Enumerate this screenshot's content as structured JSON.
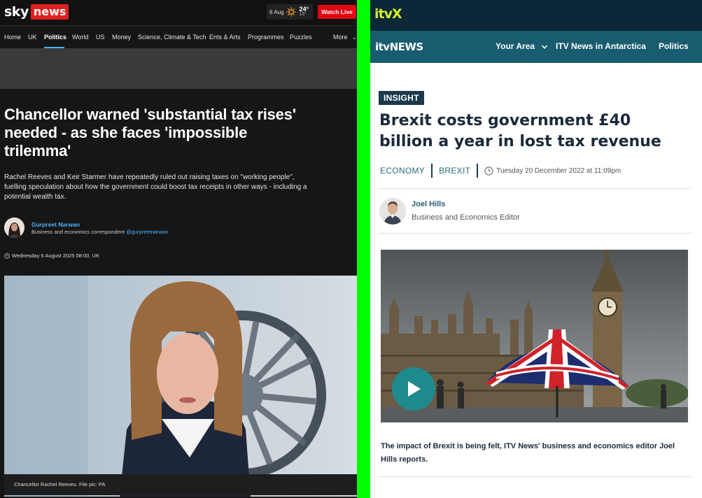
{
  "sky": {
    "logo_word": "sky",
    "logo_news": "news",
    "weather": {
      "date": "6 Aug",
      "high": "24°",
      "low": "16°"
    },
    "watch_live": "Watch Live",
    "nav": [
      "Home",
      "UK",
      "Politics",
      "World",
      "US",
      "Money",
      "Science, Climate & Tech",
      "Ents & Arts",
      "Programmes",
      "Puzzles"
    ],
    "nav_active": "Politics",
    "nav_more": "More",
    "headline": "Chancellor warned 'substantial tax rises' needed - as she faces 'impossible trilemma'",
    "standfirst": "Rachel Reeves and Keir Starmer have repeatedly ruled out raising taxes on \"working people\", fuelling speculation about how the government could boost tax receipts in other ways - including a potential wealth tax.",
    "author": {
      "name": "Gurpreet Narwan",
      "role": "Business and economics correspondent",
      "handle": "@gurpreetnarwan"
    },
    "date": "Wednesday 6 August 2025 08:00, UK",
    "caption": "Chancellor Rachel Reeves. File pic: PA"
  },
  "itv": {
    "itvx_logo": "itvX",
    "news_logo": "itvNEWS",
    "nav": {
      "your_area": "Your Area",
      "antarctica": "ITV News in Antarctica",
      "politics": "Politics"
    },
    "tag": "INSIGHT",
    "headline": "Brexit costs government £40 billion a year in lost tax revenue",
    "categories": [
      "ECONOMY",
      "BREXIT"
    ],
    "date": "Tuesday 20 December 2022 at 11:09pm",
    "author": {
      "name": "Joel Hills",
      "role": "Business and Economics Editor"
    },
    "caption": "The impact of Brexit is being felt, ITV News' business and economics editor Joel Hills reports."
  },
  "colors": {
    "sky_red": "#e30613",
    "sky_link": "#4fb4ff",
    "itv_dark": "#0c2738",
    "itv_teal": "#195c6f",
    "itvx_yellow": "#d5ef2a",
    "divider_green": "#00ff00"
  }
}
